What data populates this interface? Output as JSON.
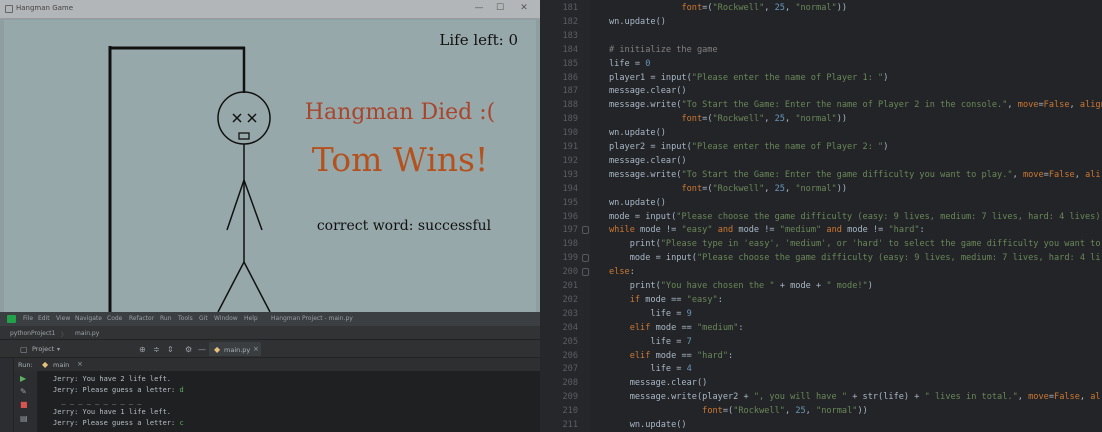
{
  "turtle_window": {
    "title": "Hangman Game",
    "controls": [
      "—",
      "☐",
      "✕"
    ],
    "life_left": "Life left: 0",
    "message_died": "Hangman Died :(",
    "message_winner": "Tom Wins!",
    "correct_word": "correct word: successful"
  },
  "ide": {
    "menu": [
      "File",
      "Edit",
      "View",
      "Navigate",
      "Code",
      "Refactor",
      "Run",
      "Tools",
      "Git",
      "Window",
      "Help",
      "Hangman Project - main.py"
    ],
    "breadcrumbs": [
      "pythonProject1",
      "main.py"
    ],
    "project_label": "Project",
    "run_tab_label": "main.py",
    "run_label": "Run:",
    "run_config": "main",
    "console_lines": [
      {
        "text": "Jerry: You have 2 life left.",
        "input": ""
      },
      {
        "text": "Jerry: Please guess a letter: ",
        "input": "d"
      },
      {
        "text": "  _ _ _ _ _ _ _ _ _ _",
        "input": ""
      },
      {
        "text": "Jerry: You have 1 life left.",
        "input": ""
      },
      {
        "text": "Jerry: Please guess a letter: ",
        "input": "c"
      }
    ]
  },
  "editor": {
    "lines": [
      {
        "n": "181",
        "fold": false,
        "html": "              <span class='kw'>font</span>=(<span class='str'>\"Rockwell\"</span>, <span class='num'>25</span>, <span class='str'>\"normal\"</span>))"
      },
      {
        "n": "182",
        "fold": false,
        "html": "wn.update()"
      },
      {
        "n": "183",
        "fold": false,
        "html": ""
      },
      {
        "n": "184",
        "fold": false,
        "html": "<span style='color:#808080'># initialize the game</span>"
      },
      {
        "n": "185",
        "fold": false,
        "html": "life = <span class='num'>0</span>"
      },
      {
        "n": "186",
        "fold": false,
        "html": "player1 = input(<span class='str'>\"Please enter the name of Player 1: \"</span>)"
      },
      {
        "n": "187",
        "fold": false,
        "html": "message.clear()"
      },
      {
        "n": "188",
        "fold": false,
        "html": "message.write(<span class='str'>\"To Start the Game: Enter the name of Player 2 in the console.\"</span>, <span class='kw'>move</span>=<span class='kw'>False</span>, <span class='kw'>align</span>"
      },
      {
        "n": "189",
        "fold": false,
        "html": "              <span class='kw'>font</span>=(<span class='str'>\"Rockwell\"</span>, <span class='num'>25</span>, <span class='str'>\"normal\"</span>))"
      },
      {
        "n": "190",
        "fold": false,
        "html": "wn.update()"
      },
      {
        "n": "191",
        "fold": false,
        "html": "player2 = input(<span class='str'>\"Please enter the name of Player 2: \"</span>)"
      },
      {
        "n": "192",
        "fold": false,
        "html": "message.clear()"
      },
      {
        "n": "193",
        "fold": false,
        "html": "message.write(<span class='str'>\"To Start the Game: Enter the game difficulty you want to play.\"</span>, <span class='kw'>move</span>=<span class='kw'>False</span>, <span class='kw'>ali</span>"
      },
      {
        "n": "194",
        "fold": false,
        "html": "              <span class='kw'>font</span>=(<span class='str'>\"Rockwell\"</span>, <span class='num'>25</span>, <span class='str'>\"normal\"</span>))"
      },
      {
        "n": "195",
        "fold": false,
        "html": "wn.update()"
      },
      {
        "n": "196",
        "fold": false,
        "html": "mode = input(<span class='str'>\"Please choose the game difficulty (easy: 9 lives, medium: 7 lives, hard: 4 lives)</span>"
      },
      {
        "n": "197",
        "fold": true,
        "html": "<span class='kw'>while</span> mode != <span class='str'>\"easy\"</span> <span class='kw'>and</span> mode != <span class='str'>\"medium\"</span> <span class='kw'>and</span> mode != <span class='str'>\"hard\"</span>:"
      },
      {
        "n": "198",
        "fold": false,
        "html": "    print(<span class='str'>\"Please type in 'easy', 'medium', or 'hard' to select the game difficulty you want to</span>"
      },
      {
        "n": "199",
        "fold": true,
        "html": "    mode = input(<span class='str'>\"Please choose the game difficulty (easy: 9 lives, medium: 7 lives, hard: 4 li</span>"
      },
      {
        "n": "200",
        "fold": true,
        "html": "<span class='kw'>else</span>:"
      },
      {
        "n": "201",
        "fold": false,
        "html": "    print(<span class='str'>\"You have chosen the \"</span> + mode + <span class='str'>\" mode!\"</span>)"
      },
      {
        "n": "202",
        "fold": false,
        "html": "    <span class='kw'>if</span> mode == <span class='str'>\"easy\"</span>:"
      },
      {
        "n": "203",
        "fold": false,
        "html": "        life = <span class='num'>9</span>"
      },
      {
        "n": "204",
        "fold": false,
        "html": "    <span class='kw'>elif</span> mode == <span class='str'>\"medium\"</span>:"
      },
      {
        "n": "205",
        "fold": false,
        "html": "        life = <span class='num'>7</span>"
      },
      {
        "n": "206",
        "fold": false,
        "html": "    <span class='kw'>elif</span> mode == <span class='str'>\"hard\"</span>:"
      },
      {
        "n": "207",
        "fold": false,
        "html": "        life = <span class='num'>4</span>"
      },
      {
        "n": "208",
        "fold": false,
        "html": "    message.clear()"
      },
      {
        "n": "209",
        "fold": false,
        "html": "    message.write(player2 + <span class='str'>\", you will have \"</span> + str(life) + <span class='str'>\" lives in total.\"</span>, <span class='kw'>move</span>=<span class='kw'>False</span>, <span class='kw'>al</span>"
      },
      {
        "n": "210",
        "fold": false,
        "html": "                  <span class='kw'>font</span>=(<span class='str'>\"Rockwell\"</span>, <span class='num'>25</span>, <span class='str'>\"normal\"</span>))"
      },
      {
        "n": "211",
        "fold": false,
        "html": "    wn.update()"
      }
    ]
  }
}
